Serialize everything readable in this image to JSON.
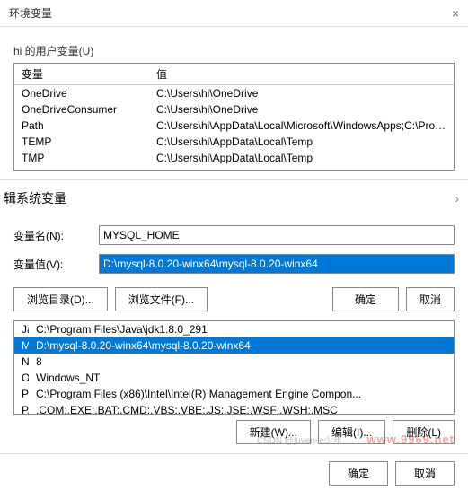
{
  "dialog": {
    "title": "环境变量",
    "close": "×"
  },
  "user_section": {
    "label": "hi 的用户变量(U)",
    "headers": {
      "name": "变量",
      "value": "值"
    },
    "rows": [
      {
        "name": "OneDrive",
        "value": "C:\\Users\\hi\\OneDrive"
      },
      {
        "name": "OneDriveConsumer",
        "value": "C:\\Users\\hi\\OneDrive"
      },
      {
        "name": "Path",
        "value": "C:\\Users\\hi\\AppData\\Local\\Microsoft\\WindowsApps;C:\\Program Fi..."
      },
      {
        "name": "TEMP",
        "value": "C:\\Users\\hi\\AppData\\Local\\Temp"
      },
      {
        "name": "TMP",
        "value": "C:\\Users\\hi\\AppData\\Local\\Temp"
      }
    ]
  },
  "edit_dialog": {
    "title": "辑系统变量",
    "chevron": "›",
    "name_label": "变量名(N):",
    "name_value": "MYSQL_HOME",
    "value_label": "变量值(V):",
    "value_value": "D:\\mysql-8.0.20-winx64\\mysql-8.0.20-winx64",
    "browse_dir": "浏览目录(D)...",
    "browse_file": "浏览文件(F)...",
    "ok": "确定",
    "cancel": "取消"
  },
  "sys_section": {
    "rows": [
      {
        "name": "Java_home",
        "value": "C:\\Program Files\\Java\\jdk1.8.0_291"
      },
      {
        "name": "MYSQL_HOME",
        "value": "D:\\mysql-8.0.20-winx64\\mysql-8.0.20-winx64",
        "highlight": true
      },
      {
        "name": "NUMBER_OF_PROCESSORS",
        "value": "8"
      },
      {
        "name": "OS",
        "value": "Windows_NT"
      },
      {
        "name": "Path",
        "value": "C:\\Program Files (x86)\\Intel\\Intel(R) Management Engine Compon..."
      },
      {
        "name": "PATHEXT",
        "value": ".COM;.EXE;.BAT;.CMD;.VBS;.VBE;.JS;.JSE;.WSF;.WSH;.MSC"
      }
    ],
    "new": "新建(W)...",
    "edit": "编辑(I)...",
    "delete": "删除(L)"
  },
  "footer": {
    "ok": "确定",
    "cancel": "取消"
  },
  "watermark": "www.9969.net",
  "watermark2": "CSDN @juvenile少年"
}
